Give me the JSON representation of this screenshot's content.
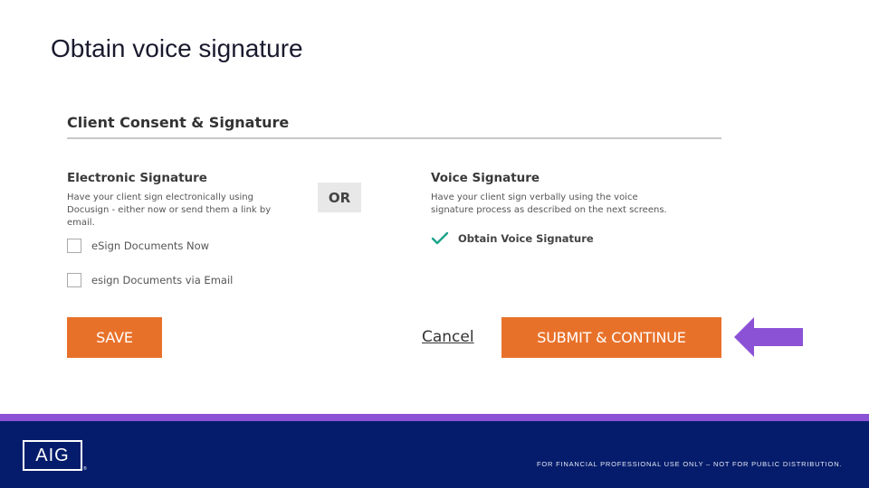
{
  "slide": {
    "title": "Obtain voice signature"
  },
  "consent": {
    "title": "Client Consent & Signature",
    "or_label": "OR",
    "electronic": {
      "heading": "Electronic Signature",
      "description": "Have your client sign electronically using Docusign - either now or send them a link by email.",
      "options": [
        {
          "label": "eSign Documents Now",
          "checked": false
        },
        {
          "label": "esign Documents via Email",
          "checked": false
        }
      ]
    },
    "voice": {
      "heading": "Voice Signature",
      "description": "Have your client sign verbally using the voice signature process as described on the next screens.",
      "confirm_label": "Obtain Voice Signature",
      "confirm_icon": "check-icon"
    }
  },
  "actions": {
    "save_label": "SAVE",
    "cancel_label": "Cancel",
    "submit_label": "SUBMIT & CONTINUE",
    "pointer_icon": "arrow-left-icon"
  },
  "footer": {
    "logo_text": "AIG",
    "logo_reg": "®",
    "disclaimer": "FOR FINANCIAL PROFESSIONAL USE ONLY – NOT FOR PUBLIC DISTRIBUTION."
  },
  "colors": {
    "accent_orange": "#e8712a",
    "check_teal": "#1aa38a",
    "arrow_purple": "#8c52d6",
    "footer_navy": "#041c6b"
  }
}
